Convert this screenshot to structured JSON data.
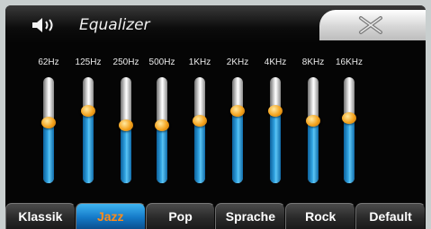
{
  "header": {
    "title": "Equalizer",
    "speaker_icon": "speaker-icon",
    "close_icon": "close-x-icon"
  },
  "bands": [
    {
      "label": "62Hz",
      "level": 0.58
    },
    {
      "label": "125Hz",
      "level": 0.69
    },
    {
      "label": "250Hz",
      "level": 0.55
    },
    {
      "label": "500Hz",
      "level": 0.55
    },
    {
      "label": "1KHz",
      "level": 0.59
    },
    {
      "label": "2KHz",
      "level": 0.69
    },
    {
      "label": "4KHz",
      "level": 0.69
    },
    {
      "label": "8KHz",
      "level": 0.59
    },
    {
      "label": "16KHz",
      "level": 0.62
    }
  ],
  "presets": [
    {
      "label": "Klassik",
      "active": false
    },
    {
      "label": "Jazz",
      "active": true
    },
    {
      "label": "Pop",
      "active": false
    },
    {
      "label": "Sprache",
      "active": false
    },
    {
      "label": "Rock",
      "active": false
    },
    {
      "label": "Default",
      "active": false
    }
  ],
  "colors": {
    "active_preset_text": "#ff8c1a",
    "slider_fill": "#35a8e6",
    "knob": "#f4a21c"
  }
}
